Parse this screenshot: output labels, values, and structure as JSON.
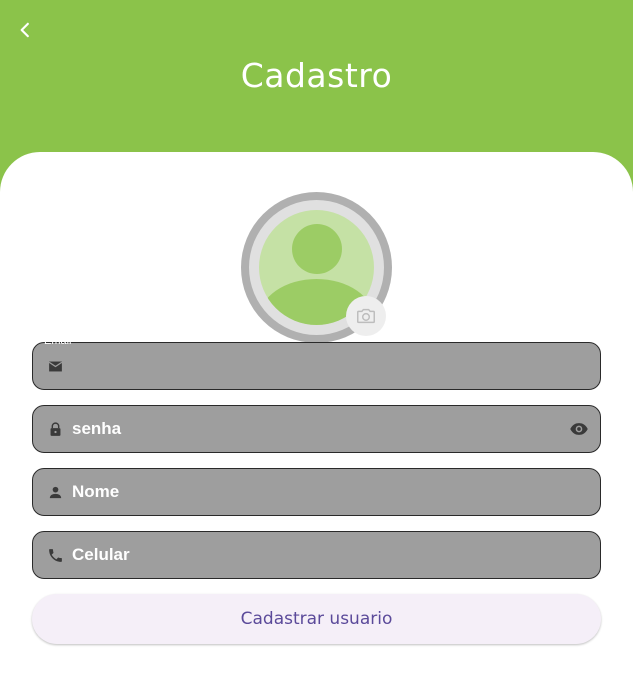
{
  "header": {
    "title": "Cadastro",
    "back_icon": "chevron-left-icon",
    "background_color": "#8bc34a"
  },
  "avatar": {
    "icon": "person-icon",
    "camera_icon": "camera-icon"
  },
  "form": {
    "email": {
      "label": "Email",
      "value": "",
      "icon": "mail-icon"
    },
    "password": {
      "placeholder": "senha",
      "icon": "lock-icon",
      "toggle_icon": "eye-icon"
    },
    "name": {
      "placeholder": "Nome",
      "icon": "person-icon"
    },
    "phone": {
      "placeholder": "Celular",
      "icon": "phone-icon"
    }
  },
  "submit_button": {
    "label": "Cadastrar usuario",
    "text_color": "#5b4a9a",
    "background_color": "#f5eff8"
  }
}
